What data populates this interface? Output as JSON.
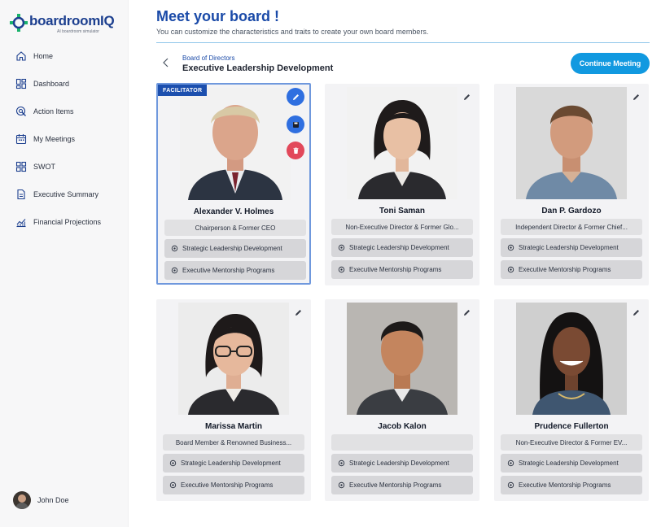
{
  "logo": {
    "name_a": "boardroom",
    "name_b": "IQ",
    "tagline": "AI boardroom simulator"
  },
  "sidebar": {
    "items": [
      {
        "label": "Home",
        "icon": "home-icon"
      },
      {
        "label": "Dashboard",
        "icon": "dashboard-icon"
      },
      {
        "label": "Action Items",
        "icon": "action-items-icon"
      },
      {
        "label": "My Meetings",
        "icon": "calendar-icon"
      },
      {
        "label": "SWOT",
        "icon": "swot-grid-icon"
      },
      {
        "label": "Executive Summary",
        "icon": "document-icon"
      },
      {
        "label": "Financial Projections",
        "icon": "chart-icon"
      }
    ],
    "user": "John Doe"
  },
  "header": {
    "title": "Meet your board !",
    "subtitle": "You can customize the characteristics and traits to create your own board members.",
    "breadcrumb_parent": "Board of Directors",
    "breadcrumb_current": "Executive Leadership Development",
    "continue_label": "Continue Meeting"
  },
  "colors": {
    "primary": "#1a4aa8",
    "accent": "#1199e0",
    "edit": "#2f6fe0",
    "delete": "#e2485a",
    "card": "#f3f3f5"
  },
  "facilitator_label": "FACILITATOR",
  "members": [
    {
      "name": "Alexander V. Holmes",
      "role": "Chairperson & Former CEO",
      "traits": [
        "Strategic Leadership Development",
        "Executive Mentorship Programs"
      ]
    },
    {
      "name": "Toni Saman",
      "role": "Non-Executive Director & Former Glo...",
      "traits": [
        "Strategic Leadership Development",
        "Executive Mentorship Programs"
      ]
    },
    {
      "name": "Dan P. Gardozo",
      "role": "Independent Director & Former Chief...",
      "traits": [
        "Strategic Leadership Development",
        "Executive Mentorship Programs"
      ]
    },
    {
      "name": "Marissa Martin",
      "role": "Board Member & Renowned Business...",
      "traits": [
        "Strategic Leadership Development",
        "Executive Mentorship Programs"
      ]
    },
    {
      "name": "Jacob Kalon",
      "role": "",
      "traits": [
        "Strategic Leadership Development",
        "Executive Mentorship Programs"
      ]
    },
    {
      "name": "Prudence Fullerton",
      "role": "Non-Executive Director & Former EV...",
      "traits": [
        "Strategic Leadership Development",
        "Executive Mentorship Programs"
      ]
    }
  ]
}
